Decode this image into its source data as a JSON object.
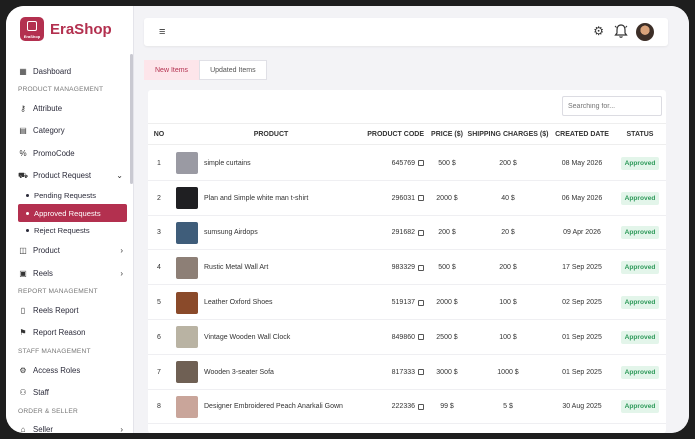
{
  "brand": {
    "name": "EraShop",
    "logo_text": "EraShop"
  },
  "sidebar": {
    "items": [
      {
        "type": "item",
        "label": "Dashboard",
        "icon": "dashboard-icon",
        "glyph": "▦"
      },
      {
        "type": "section",
        "label": "PRODUCT MANAGEMENT"
      },
      {
        "type": "item",
        "label": "Attribute",
        "icon": "key-icon",
        "glyph": "⚷"
      },
      {
        "type": "item",
        "label": "Category",
        "icon": "grid-icon",
        "glyph": "▤"
      },
      {
        "type": "item",
        "label": "PromoCode",
        "icon": "percent-icon",
        "glyph": "%"
      },
      {
        "type": "item",
        "label": "Product Request",
        "icon": "cart-icon",
        "glyph": "⛟",
        "chevron": "⌄"
      },
      {
        "type": "sub",
        "label": "Pending Requests"
      },
      {
        "type": "sub",
        "label": "Approved Requests",
        "active": true
      },
      {
        "type": "sub",
        "label": "Reject Requests"
      },
      {
        "type": "item",
        "label": "Product",
        "icon": "box-icon",
        "glyph": "◫",
        "chevron": "›"
      },
      {
        "type": "item",
        "label": "Reels",
        "icon": "film-icon",
        "glyph": "▣",
        "chevron": "›"
      },
      {
        "type": "section",
        "label": "REPORT MANAGEMENT"
      },
      {
        "type": "item",
        "label": "Reels Report",
        "icon": "report-icon",
        "glyph": "▯"
      },
      {
        "type": "item",
        "label": "Report Reason",
        "icon": "flag-icon",
        "glyph": "⚑"
      },
      {
        "type": "section",
        "label": "STAFF MANAGEMENT"
      },
      {
        "type": "item",
        "label": "Access Roles",
        "icon": "role-icon",
        "glyph": "⚙"
      },
      {
        "type": "item",
        "label": "Staff",
        "icon": "users-icon",
        "glyph": "⚇"
      },
      {
        "type": "section",
        "label": "ORDER & SELLER"
      },
      {
        "type": "item",
        "label": "Seller",
        "icon": "store-icon",
        "glyph": "⌂",
        "chevron": "›"
      }
    ]
  },
  "topbar": {
    "menu_glyph": "≡",
    "settings_glyph": "⚙"
  },
  "tabs": [
    {
      "label": "New Items",
      "active": true
    },
    {
      "label": "Updated Items",
      "active": false
    }
  ],
  "search": {
    "placeholder": "Searching for..."
  },
  "table": {
    "headers": [
      "NO",
      "PRODUCT",
      "PRODUCT CODE",
      "PRICE ($)",
      "SHIPPING CHARGES ($)",
      "CREATED DATE",
      "STATUS"
    ],
    "rows": [
      {
        "no": "1",
        "product": "simple curtains",
        "code": "645769",
        "price": "500 $",
        "shipping": "200 $",
        "date": "08 May 2026",
        "status": "Approved",
        "thumb": "#9a9aa3"
      },
      {
        "no": "2",
        "product": "Plan and Simple white man t-shirt",
        "code": "296031",
        "price": "2000 $",
        "shipping": "40 $",
        "date": "06 May 2026",
        "status": "Approved",
        "thumb": "#1f1f22"
      },
      {
        "no": "3",
        "product": "sumsung Airdops",
        "code": "291682",
        "price": "200 $",
        "shipping": "20 $",
        "date": "09 Apr 2026",
        "status": "Approved",
        "thumb": "#3f5d7a"
      },
      {
        "no": "4",
        "product": "Rustic Metal Wall Art",
        "code": "983329",
        "price": "500 $",
        "shipping": "200 $",
        "date": "17 Sep 2025",
        "status": "Approved",
        "thumb": "#8d7f76"
      },
      {
        "no": "5",
        "product": "Leather Oxford Shoes",
        "code": "519137",
        "price": "2000 $",
        "shipping": "100 $",
        "date": "02 Sep 2025",
        "status": "Approved",
        "thumb": "#8a4a2a"
      },
      {
        "no": "6",
        "product": "Vintage Wooden Wall Clock",
        "code": "849860",
        "price": "2500 $",
        "shipping": "100 $",
        "date": "01 Sep 2025",
        "status": "Approved",
        "thumb": "#b9b3a3"
      },
      {
        "no": "7",
        "product": "Wooden 3-seater Sofa",
        "code": "817333",
        "price": "3000 $",
        "shipping": "1000 $",
        "date": "01 Sep 2025",
        "status": "Approved",
        "thumb": "#6f6054"
      },
      {
        "no": "8",
        "product": "Designer Embroidered Peach Anarkali Gown",
        "code": "222336",
        "price": "99 $",
        "shipping": "5 $",
        "date": "30 Aug 2025",
        "status": "Approved",
        "thumb": "#c9a59a"
      }
    ]
  },
  "colors": {
    "accent": "#b3304f",
    "approved_bg": "#e3f5ea",
    "approved_text": "#2e9a5a"
  }
}
